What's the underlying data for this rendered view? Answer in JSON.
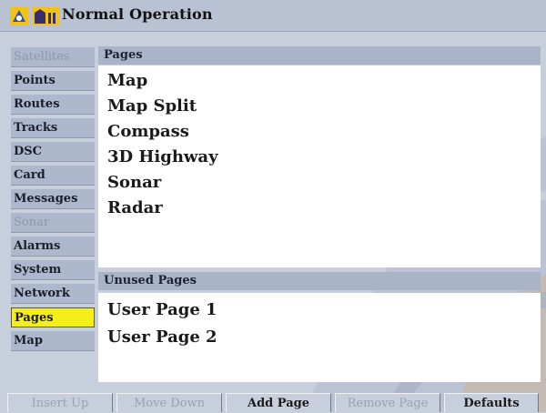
{
  "titlebar": {
    "title": "Normal Operation"
  },
  "sidebar": {
    "items": [
      {
        "label": "Satellites",
        "state": "disabled"
      },
      {
        "label": "Points",
        "state": "normal"
      },
      {
        "label": "Routes",
        "state": "normal"
      },
      {
        "label": "Tracks",
        "state": "normal"
      },
      {
        "label": "DSC",
        "state": "normal"
      },
      {
        "label": "Card",
        "state": "normal"
      },
      {
        "label": "Messages",
        "state": "normal"
      },
      {
        "label": "Sonar",
        "state": "disabled"
      },
      {
        "label": "Alarms",
        "state": "normal"
      },
      {
        "label": "System",
        "state": "normal"
      },
      {
        "label": "Network",
        "state": "normal"
      },
      {
        "label": "Pages",
        "state": "selected"
      },
      {
        "label": "Map",
        "state": "normal"
      }
    ]
  },
  "pages_panel": {
    "header": "Pages",
    "items": [
      "Map",
      "Map Split",
      "Compass",
      "3D Highway",
      "Sonar",
      "Radar"
    ]
  },
  "unused_panel": {
    "header": "Unused Pages",
    "items": [
      "User Page 1",
      "User Page 2"
    ]
  },
  "buttons": {
    "labels": [
      "Insert Up",
      "Move Down",
      "Add Page",
      "Remove Page",
      "Defaults"
    ]
  },
  "colors": {
    "selected": "#f4ef18",
    "background": "#c7cfdd",
    "panel_header": "#a9b4c9"
  },
  "icons": [
    "gps-app-icon",
    "normal-operation-mode-icon"
  ]
}
